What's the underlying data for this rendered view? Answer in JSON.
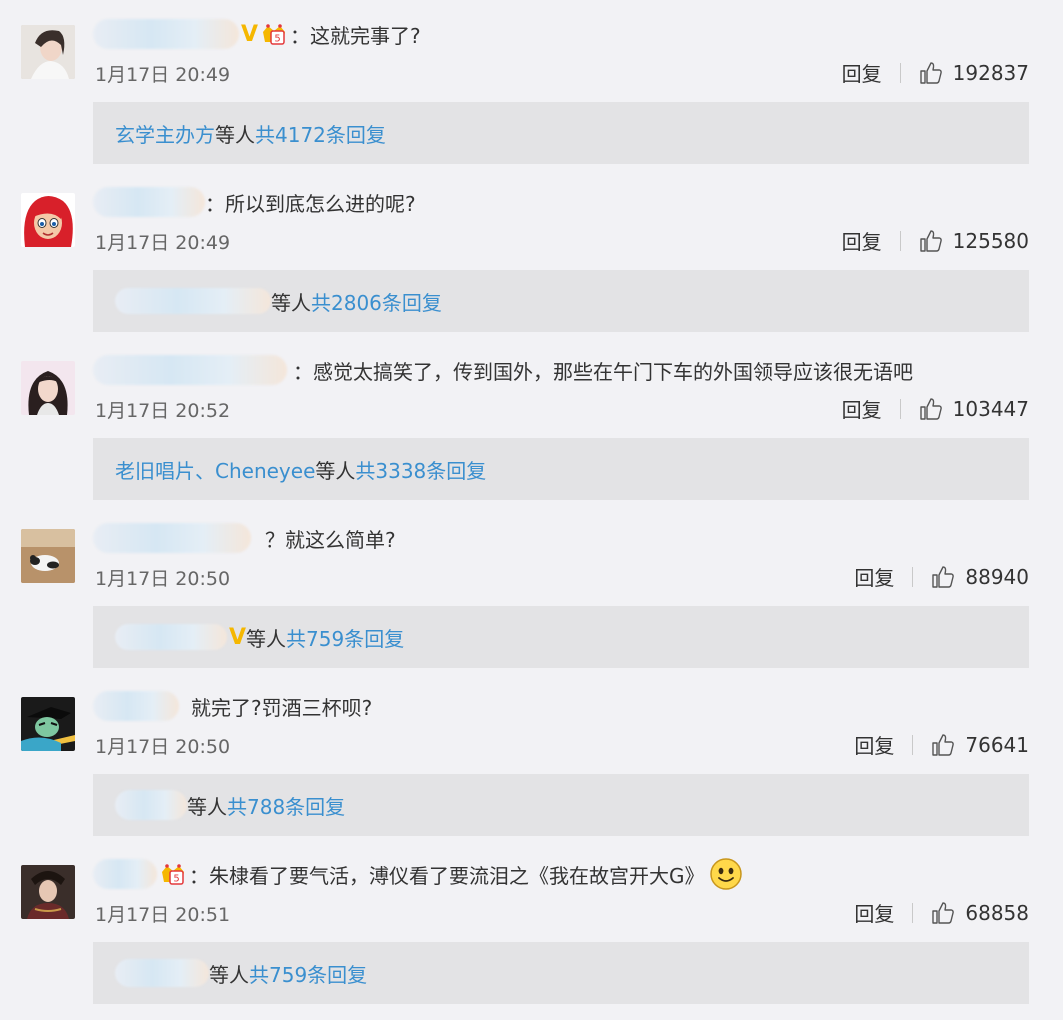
{
  "comments": [
    {
      "text": "：这就完事了?",
      "vip_mark": "V",
      "time": "1月17日 20:49",
      "reply_label": "回复",
      "likes": "192837",
      "sub_names": "玄学主办方",
      "sub_etc": " 等人 ",
      "sub_total": "共4172条回复",
      "avatar": "woman-portrait"
    },
    {
      "text": "：所以到底怎么进的呢?",
      "time": "1月17日 20:49",
      "reply_label": "回复",
      "likes": "125580",
      "sub_names": "",
      "sub_etc": "等人 ",
      "sub_total": "共2806条回复",
      "avatar": "cartoon-red-hair"
    },
    {
      "text": "：感觉太搞笑了，传到国外，那些在午门下车的外国领导应该很无语吧",
      "time": "1月17日 20:52",
      "reply_label": "回复",
      "likes": "103447",
      "sub_names": "老旧唱片、Cheneyee",
      "sub_etc": " 等人 ",
      "sub_total": "共3338条回复",
      "avatar": "woman-long-hair"
    },
    {
      "text": "？就这么简单?",
      "time": "1月17日 20:50",
      "reply_label": "回复",
      "likes": "88940",
      "sub_names": "",
      "vip_mark": "V",
      "sub_etc": " 等人 ",
      "sub_total": "共759条回复",
      "avatar": "panda-photo"
    },
    {
      "text": "就完了?罚酒三杯呗?",
      "time": "1月17日 20:50",
      "reply_label": "回复",
      "likes": "76641",
      "sub_names": "",
      "sub_etc": "等人 ",
      "sub_total": "共788条回复",
      "avatar": "anime-character"
    },
    {
      "text": "：朱棣看了要气活，溥仪看了要流泪之《我在故宫开大G》",
      "time": "1月17日 20:51",
      "reply_label": "回复",
      "likes": "68858",
      "sub_names": "",
      "sub_etc": " 等人 ",
      "sub_total": "共759条回复",
      "avatar": "woman-costume"
    }
  ],
  "colors": {
    "link": "#3a8fcf",
    "vip": "#f5b700",
    "background": "#f2f2f5",
    "sub_bg": "#e3e3e5"
  },
  "icons": [
    "like-icon",
    "crown-icon",
    "smile-icon"
  ]
}
